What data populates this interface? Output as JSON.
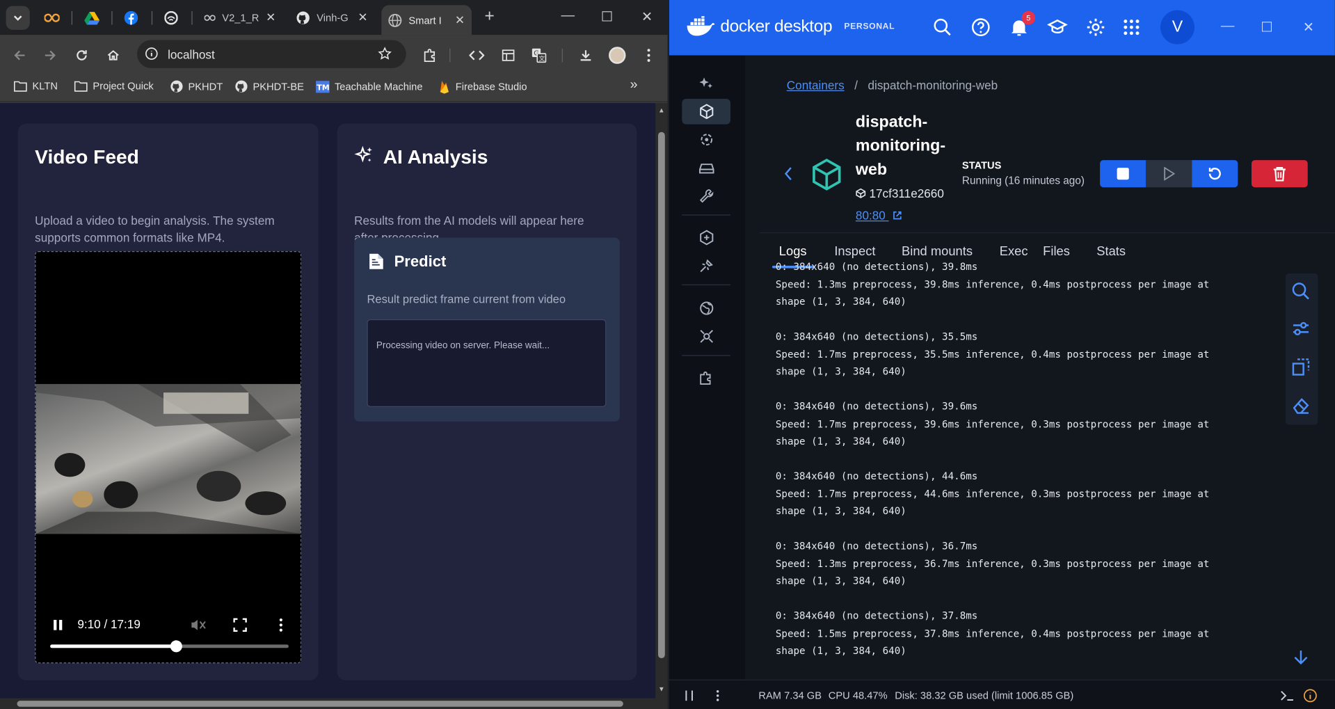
{
  "browser": {
    "tabs": [
      {
        "label": "",
        "icon": "infinity-icon"
      },
      {
        "label": "",
        "icon": "google-drive-icon"
      },
      {
        "label": "",
        "icon": "facebook-icon"
      },
      {
        "label": "",
        "icon": "circle-logo-icon"
      },
      {
        "label": "V2_1_R",
        "icon": "infinity-icon"
      },
      {
        "label": "Vinh-G",
        "icon": "github-icon"
      },
      {
        "label": "Smart I",
        "icon": "globe-icon"
      }
    ],
    "url": "localhost",
    "bookmarks": [
      "KLTN",
      "Project Quick",
      "PKHDT",
      "PKHDT-BE",
      "Teachable Machine",
      "Firebase Studio"
    ],
    "bookmarks_more": "»"
  },
  "webapp": {
    "video_card": {
      "title": "Video Feed",
      "description": "Upload a video to begin analysis. The system supports common formats like MP4.",
      "time": "9:10 / 17:19",
      "progress_fraction": 0.527
    },
    "ai_card": {
      "title": "AI Analysis",
      "description": "Results from the AI models will appear here after processing.",
      "predict_title": "Predict",
      "predict_subtitle": "Result predict frame current from video",
      "predict_output": "Processing video on server. Please wait..."
    }
  },
  "docker": {
    "brand": "docker desktop",
    "plan": "PERSONAL",
    "notification_count": "5",
    "avatar_initial": "V",
    "breadcrumb": {
      "root": "Containers",
      "separator": "/",
      "current": "dispatch-monitoring-web"
    },
    "container": {
      "name": "dispatch-monitoring-web",
      "id": "17cf311e2660",
      "port": "80:80",
      "status_label": "STATUS",
      "status_value": "Running (16 minutes ago)"
    },
    "tabs": [
      "Logs",
      "Inspect",
      "Bind mounts",
      "Exec",
      "Files",
      "Stats"
    ],
    "logs": [
      "0: 384x640 (no detections), 39.8ms",
      "Speed: 1.3ms preprocess, 39.8ms inference, 0.4ms postprocess per image at",
      "shape (1, 3, 384, 640)",
      "",
      "0: 384x640 (no detections), 35.5ms",
      "Speed: 1.7ms preprocess, 35.5ms inference, 0.4ms postprocess per image at",
      "shape (1, 3, 384, 640)",
      "",
      "0: 384x640 (no detections), 39.6ms",
      "Speed: 1.7ms preprocess, 39.6ms inference, 0.3ms postprocess per image at",
      "shape (1, 3, 384, 640)",
      "",
      "0: 384x640 (no detections), 44.6ms",
      "Speed: 1.7ms preprocess, 44.6ms inference, 0.3ms postprocess per image at",
      "shape (1, 3, 384, 640)",
      "",
      "0: 384x640 (no detections), 36.7ms",
      "Speed: 1.3ms preprocess, 36.7ms inference, 0.3ms postprocess per image at",
      "shape (1, 3, 384, 640)",
      "",
      "0: 384x640 (no detections), 37.8ms",
      "Speed: 1.5ms preprocess, 37.8ms inference, 0.4ms postprocess per image at",
      "shape (1, 3, 384, 640)"
    ],
    "footer": {
      "ram": "RAM 7.34 GB",
      "cpu": "CPU 48.47%",
      "disk": "Disk: 38.32 GB used (limit 1006.85 GB)"
    },
    "colors": {
      "header": "#1d63ed",
      "accent": "#4d8ff8",
      "danger": "#d52536"
    }
  }
}
